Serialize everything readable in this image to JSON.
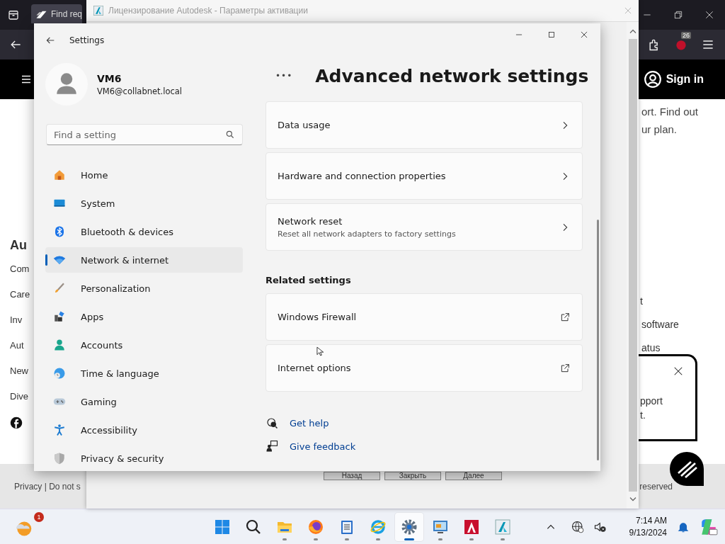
{
  "browser": {
    "tab_title": "Find req",
    "extension_badge": "26",
    "sign_in": "Sign in",
    "page_left": {
      "heading": "Au",
      "links": [
        "Com",
        "Care",
        "Inv",
        "Aut",
        "New",
        "Dive"
      ]
    },
    "page_right": {
      "intro": [
        "ort. Find out",
        "ur plan."
      ],
      "links": [
        "t",
        "software",
        "atus"
      ]
    },
    "footer_left": "Privacy | Do not s",
    "footer_right": "reserved"
  },
  "license_window": {
    "title": "Лицензирование Autodesk - Параметры активации",
    "buttons": [
      "Назад",
      "Закрыть",
      "Далее"
    ]
  },
  "popup": {
    "lines": [
      "pport",
      "t."
    ]
  },
  "settings": {
    "title": "Settings",
    "user": {
      "name": "VM6",
      "email": "VM6@collabnet.local"
    },
    "search": {
      "placeholder": "Find a setting"
    },
    "nav": [
      {
        "label": "Home",
        "kind": "home",
        "selected": false
      },
      {
        "label": "System",
        "kind": "system",
        "selected": false
      },
      {
        "label": "Bluetooth & devices",
        "kind": "bluetooth",
        "selected": false
      },
      {
        "label": "Network & internet",
        "kind": "network",
        "selected": true
      },
      {
        "label": "Personalization",
        "kind": "brush",
        "selected": false
      },
      {
        "label": "Apps",
        "kind": "apps",
        "selected": false
      },
      {
        "label": "Accounts",
        "kind": "accounts",
        "selected": false
      },
      {
        "label": "Time & language",
        "kind": "time",
        "selected": false
      },
      {
        "label": "Gaming",
        "kind": "gaming",
        "selected": false
      },
      {
        "label": "Accessibility",
        "kind": "accessibility",
        "selected": false
      },
      {
        "label": "Privacy & security",
        "kind": "privacy",
        "selected": false
      }
    ],
    "breadcrumb_more": "•••",
    "page_title": "Advanced network settings",
    "cards": [
      {
        "title": "Data usage",
        "kind": "chevron"
      },
      {
        "title": "Hardware and connection properties",
        "kind": "chevron"
      },
      {
        "title": "Network reset",
        "subtitle": "Reset all network adapters to factory settings",
        "kind": "chevron"
      }
    ],
    "related_heading": "Related settings",
    "related": [
      {
        "title": "Windows Firewall",
        "kind": "external"
      },
      {
        "title": "Internet options",
        "kind": "external"
      }
    ],
    "help_links": [
      {
        "label": "Get help",
        "kind": "help"
      },
      {
        "label": "Give feedback",
        "kind": "feedback"
      }
    ]
  },
  "taskbar": {
    "weather_badge": "1",
    "apps": [
      {
        "kind": "start",
        "running": false,
        "active": false
      },
      {
        "kind": "search",
        "running": false,
        "active": false
      },
      {
        "kind": "folder",
        "running": true,
        "active": false
      },
      {
        "kind": "firefox",
        "running": true,
        "active": false
      },
      {
        "kind": "notepad",
        "running": true,
        "active": false
      },
      {
        "kind": "ie",
        "running": true,
        "active": false
      },
      {
        "kind": "settings",
        "running": true,
        "active": true
      },
      {
        "kind": "remote",
        "running": true,
        "active": false
      },
      {
        "kind": "autocad",
        "running": true,
        "active": false
      },
      {
        "kind": "autodesk",
        "running": true,
        "active": false
      }
    ],
    "time": "7:14 AM",
    "date": "9/13/2024"
  }
}
